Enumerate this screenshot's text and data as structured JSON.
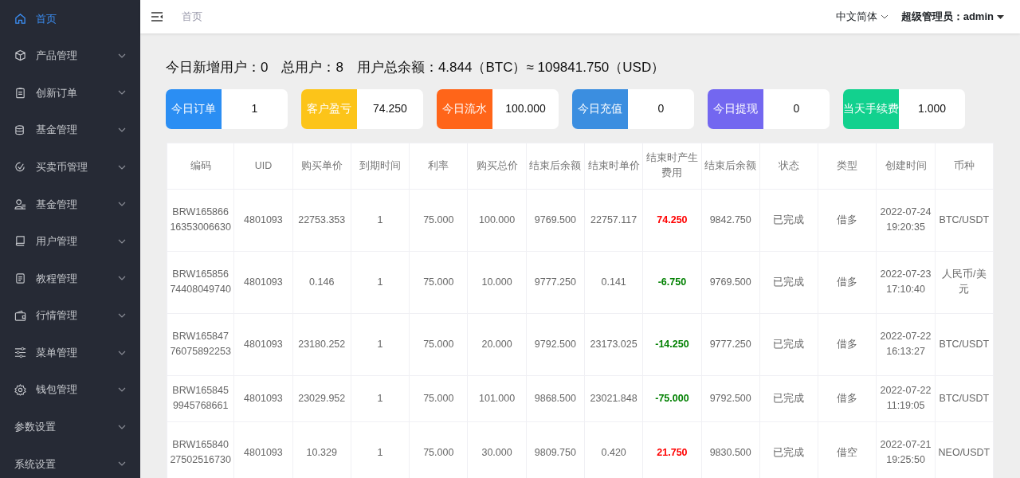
{
  "sidebar": {
    "items": [
      {
        "label": "首页",
        "selected": true,
        "has_submenu": false
      },
      {
        "label": "产品管理",
        "selected": false,
        "has_submenu": true
      },
      {
        "label": "创新订单",
        "selected": false,
        "has_submenu": true
      },
      {
        "label": "基金管理",
        "selected": false,
        "has_submenu": true
      },
      {
        "label": "买卖币管理",
        "selected": false,
        "has_submenu": true
      },
      {
        "label": "基金管理",
        "selected": false,
        "has_submenu": true
      },
      {
        "label": "用户管理",
        "selected": false,
        "has_submenu": true
      },
      {
        "label": "教程管理",
        "selected": false,
        "has_submenu": true
      },
      {
        "label": "行情管理",
        "selected": false,
        "has_submenu": true
      },
      {
        "label": "菜单管理",
        "selected": false,
        "has_submenu": true
      },
      {
        "label": "钱包管理",
        "selected": false,
        "has_submenu": true
      },
      {
        "label": "参数设置",
        "selected": false,
        "has_submenu": true
      },
      {
        "label": "系统设置",
        "selected": false,
        "has_submenu": true
      }
    ]
  },
  "header": {
    "breadcrumb": "首页",
    "language": "中文简体",
    "user": "超级管理员：admin"
  },
  "summary": "今日新增用户：0　总用户：8　用户总余额：4.844（BTC）≈ 109841.750（USD）",
  "stats": [
    {
      "label": "今日订单",
      "value": "1",
      "color": "#2b8ef3"
    },
    {
      "label": "客户盈亏",
      "value": "74.250",
      "color": "#fcc419"
    },
    {
      "label": "今日流水",
      "value": "100.000",
      "color": "#ff6519"
    },
    {
      "label": "今日充值",
      "value": "0",
      "color": "#3b8ee0"
    },
    {
      "label": "今日提现",
      "value": "0",
      "color": "#7367f0"
    },
    {
      "label": "当天手续费",
      "value": "1.000",
      "color": "#12d18e"
    }
  ],
  "table": {
    "columns": [
      "编码",
      "UID",
      "购买单价",
      "到期时间",
      "利率",
      "购买总价",
      "结束后余额",
      "结束时单价",
      "结束时产生费用",
      "结束后余额",
      "状态",
      "类型",
      "创建时间",
      "币种"
    ],
    "rows": [
      {
        "cells": [
          "BRW16586616353006630",
          "4801093",
          "22753.353",
          "1",
          "75.000",
          "100.000",
          "9769.500",
          "22757.117",
          {
            "text": "74.250",
            "color": "#ff0000"
          },
          "9842.750",
          "已完成",
          "借多",
          "2022-07-24 19:20:35",
          "BTC/USDT"
        ]
      },
      {
        "cells": [
          "BRW16585674408049740",
          "4801093",
          "0.146",
          "1",
          "75.000",
          "10.000",
          "9777.250",
          "0.141",
          {
            "text": "-6.750",
            "color": "#008000"
          },
          "9769.500",
          "已完成",
          "借多",
          "2022-07-23 17:10:40",
          "人民币/美元"
        ]
      },
      {
        "cells": [
          "BRW16584776075892253",
          "4801093",
          "23180.252",
          "1",
          "75.000",
          "20.000",
          "9792.500",
          "23173.025",
          {
            "text": "-14.250",
            "color": "#008000"
          },
          "9777.250",
          "已完成",
          "借多",
          "2022-07-22 16:13:27",
          "BTC/USDT"
        ]
      },
      {
        "cells": [
          "BRW1658459945768661",
          "4801093",
          "23029.952",
          "1",
          "75.000",
          "101.000",
          "9868.500",
          "23021.848",
          {
            "text": "-75.000",
            "color": "#008000"
          },
          "9792.500",
          "已完成",
          "借多",
          "2022-07-22 11:19:05",
          "BTC/USDT"
        ]
      },
      {
        "cells": [
          "BRW16584027502516730",
          "4801093",
          "10.329",
          "1",
          "75.000",
          "30.000",
          "9809.750",
          "0.420",
          {
            "text": "21.750",
            "color": "#ff0000"
          },
          "9830.500",
          "已完成",
          "借空",
          "2022-07-21 19:25:50",
          "NEO/USDT"
        ]
      }
    ]
  }
}
